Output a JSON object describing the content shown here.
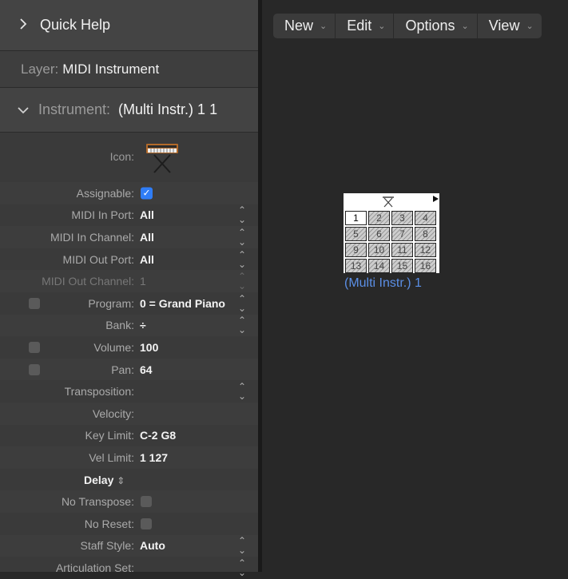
{
  "quick_help": {
    "label": "Quick Help"
  },
  "layer": {
    "label": "Layer:",
    "value": "MIDI Instrument"
  },
  "instrument": {
    "label": "Instrument:",
    "value": "(Multi Instr.) 1 1"
  },
  "icon_row": {
    "label": "Icon:",
    "icon": "keyboard-synth-icon"
  },
  "params": {
    "assignable": {
      "label": "Assignable:",
      "checked": true
    },
    "midi_in_port": {
      "label": "MIDI In Port:",
      "value": "All"
    },
    "midi_in_channel": {
      "label": "MIDI In Channel:",
      "value": "All"
    },
    "midi_out_port": {
      "label": "MIDI Out Port:",
      "value": "All"
    },
    "midi_out_channel": {
      "label": "MIDI Out Channel:",
      "value": "1"
    },
    "program": {
      "label": "Program:",
      "value": "0 = Grand Piano"
    },
    "bank": {
      "label": "Bank:",
      "value": "÷"
    },
    "volume": {
      "label": "Volume:",
      "value": "100"
    },
    "pan": {
      "label": "Pan:",
      "value": "64"
    },
    "transposition": {
      "label": "Transposition:",
      "value": ""
    },
    "velocity": {
      "label": "Velocity:",
      "value": ""
    },
    "key_limit": {
      "label": "Key Limit:",
      "value": "C-2  G8"
    },
    "vel_limit": {
      "label": "Vel Limit:",
      "value": "1  127"
    },
    "delay": {
      "label": "Delay"
    },
    "no_transpose": {
      "label": "No Transpose:"
    },
    "no_reset": {
      "label": "No Reset:"
    },
    "staff_style": {
      "label": "Staff Style:",
      "value": "Auto"
    },
    "articulation_set": {
      "label": "Articulation Set:",
      "value": ""
    }
  },
  "toolbar": {
    "new": "New",
    "edit": "Edit",
    "options": "Options",
    "view": "View"
  },
  "environment_object": {
    "label": "(Multi Instr.) 1",
    "channels": [
      "1",
      "2",
      "3",
      "4",
      "5",
      "6",
      "7",
      "8",
      "9",
      "10",
      "11",
      "12",
      "13",
      "14",
      "15",
      "16"
    ]
  },
  "colors": {
    "accent": "#2f7df6",
    "object_label": "#5b8fe6"
  }
}
